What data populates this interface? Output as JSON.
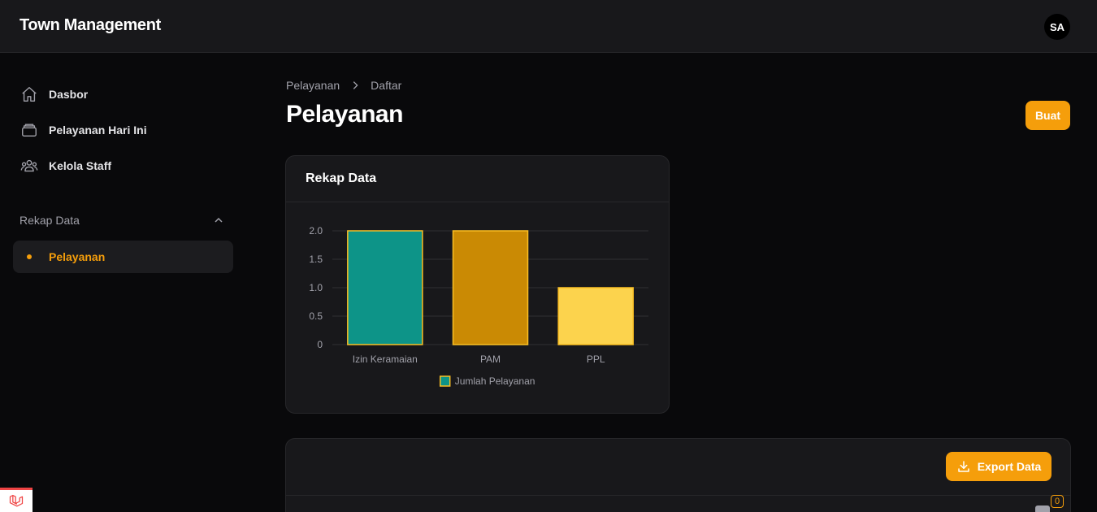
{
  "app": {
    "title": "Town Management",
    "avatar_initials": "SA"
  },
  "sidebar": {
    "items": [
      {
        "label": "Dasbor",
        "icon": "home-icon"
      },
      {
        "label": "Pelayanan Hari Ini",
        "icon": "inbox-icon"
      },
      {
        "label": "Kelola Staff",
        "icon": "users-icon"
      }
    ],
    "group": {
      "label": "Rekap Data",
      "items": [
        {
          "label": "Pelayanan",
          "active": true
        }
      ]
    }
  },
  "breadcrumb": {
    "items": [
      "Pelayanan",
      "Daftar"
    ]
  },
  "page": {
    "title": "Pelayanan",
    "create_label": "Buat"
  },
  "chart_card": {
    "title": "Rekap Data"
  },
  "chart_data": {
    "type": "bar",
    "categories": [
      "Izin Keramaian",
      "PAM",
      "PPL"
    ],
    "series": [
      {
        "name": "Jumlah Pelayanan",
        "values": [
          2,
          2,
          1
        ]
      }
    ],
    "bar_colors": [
      "#0d9488",
      "#ca8a04",
      "#fcd34d"
    ],
    "border_color": "#fbbf24",
    "ylim": [
      0,
      2
    ],
    "yticks": [
      "2.0",
      "1.5",
      "1.0",
      "0.5",
      "0"
    ],
    "grid": true,
    "legend": "bottom"
  },
  "table": {
    "export_label": "Export Data",
    "filter_count": "0"
  },
  "colors": {
    "accent": "#f59e0b",
    "background": "#09090b",
    "surface": "#18181b"
  }
}
